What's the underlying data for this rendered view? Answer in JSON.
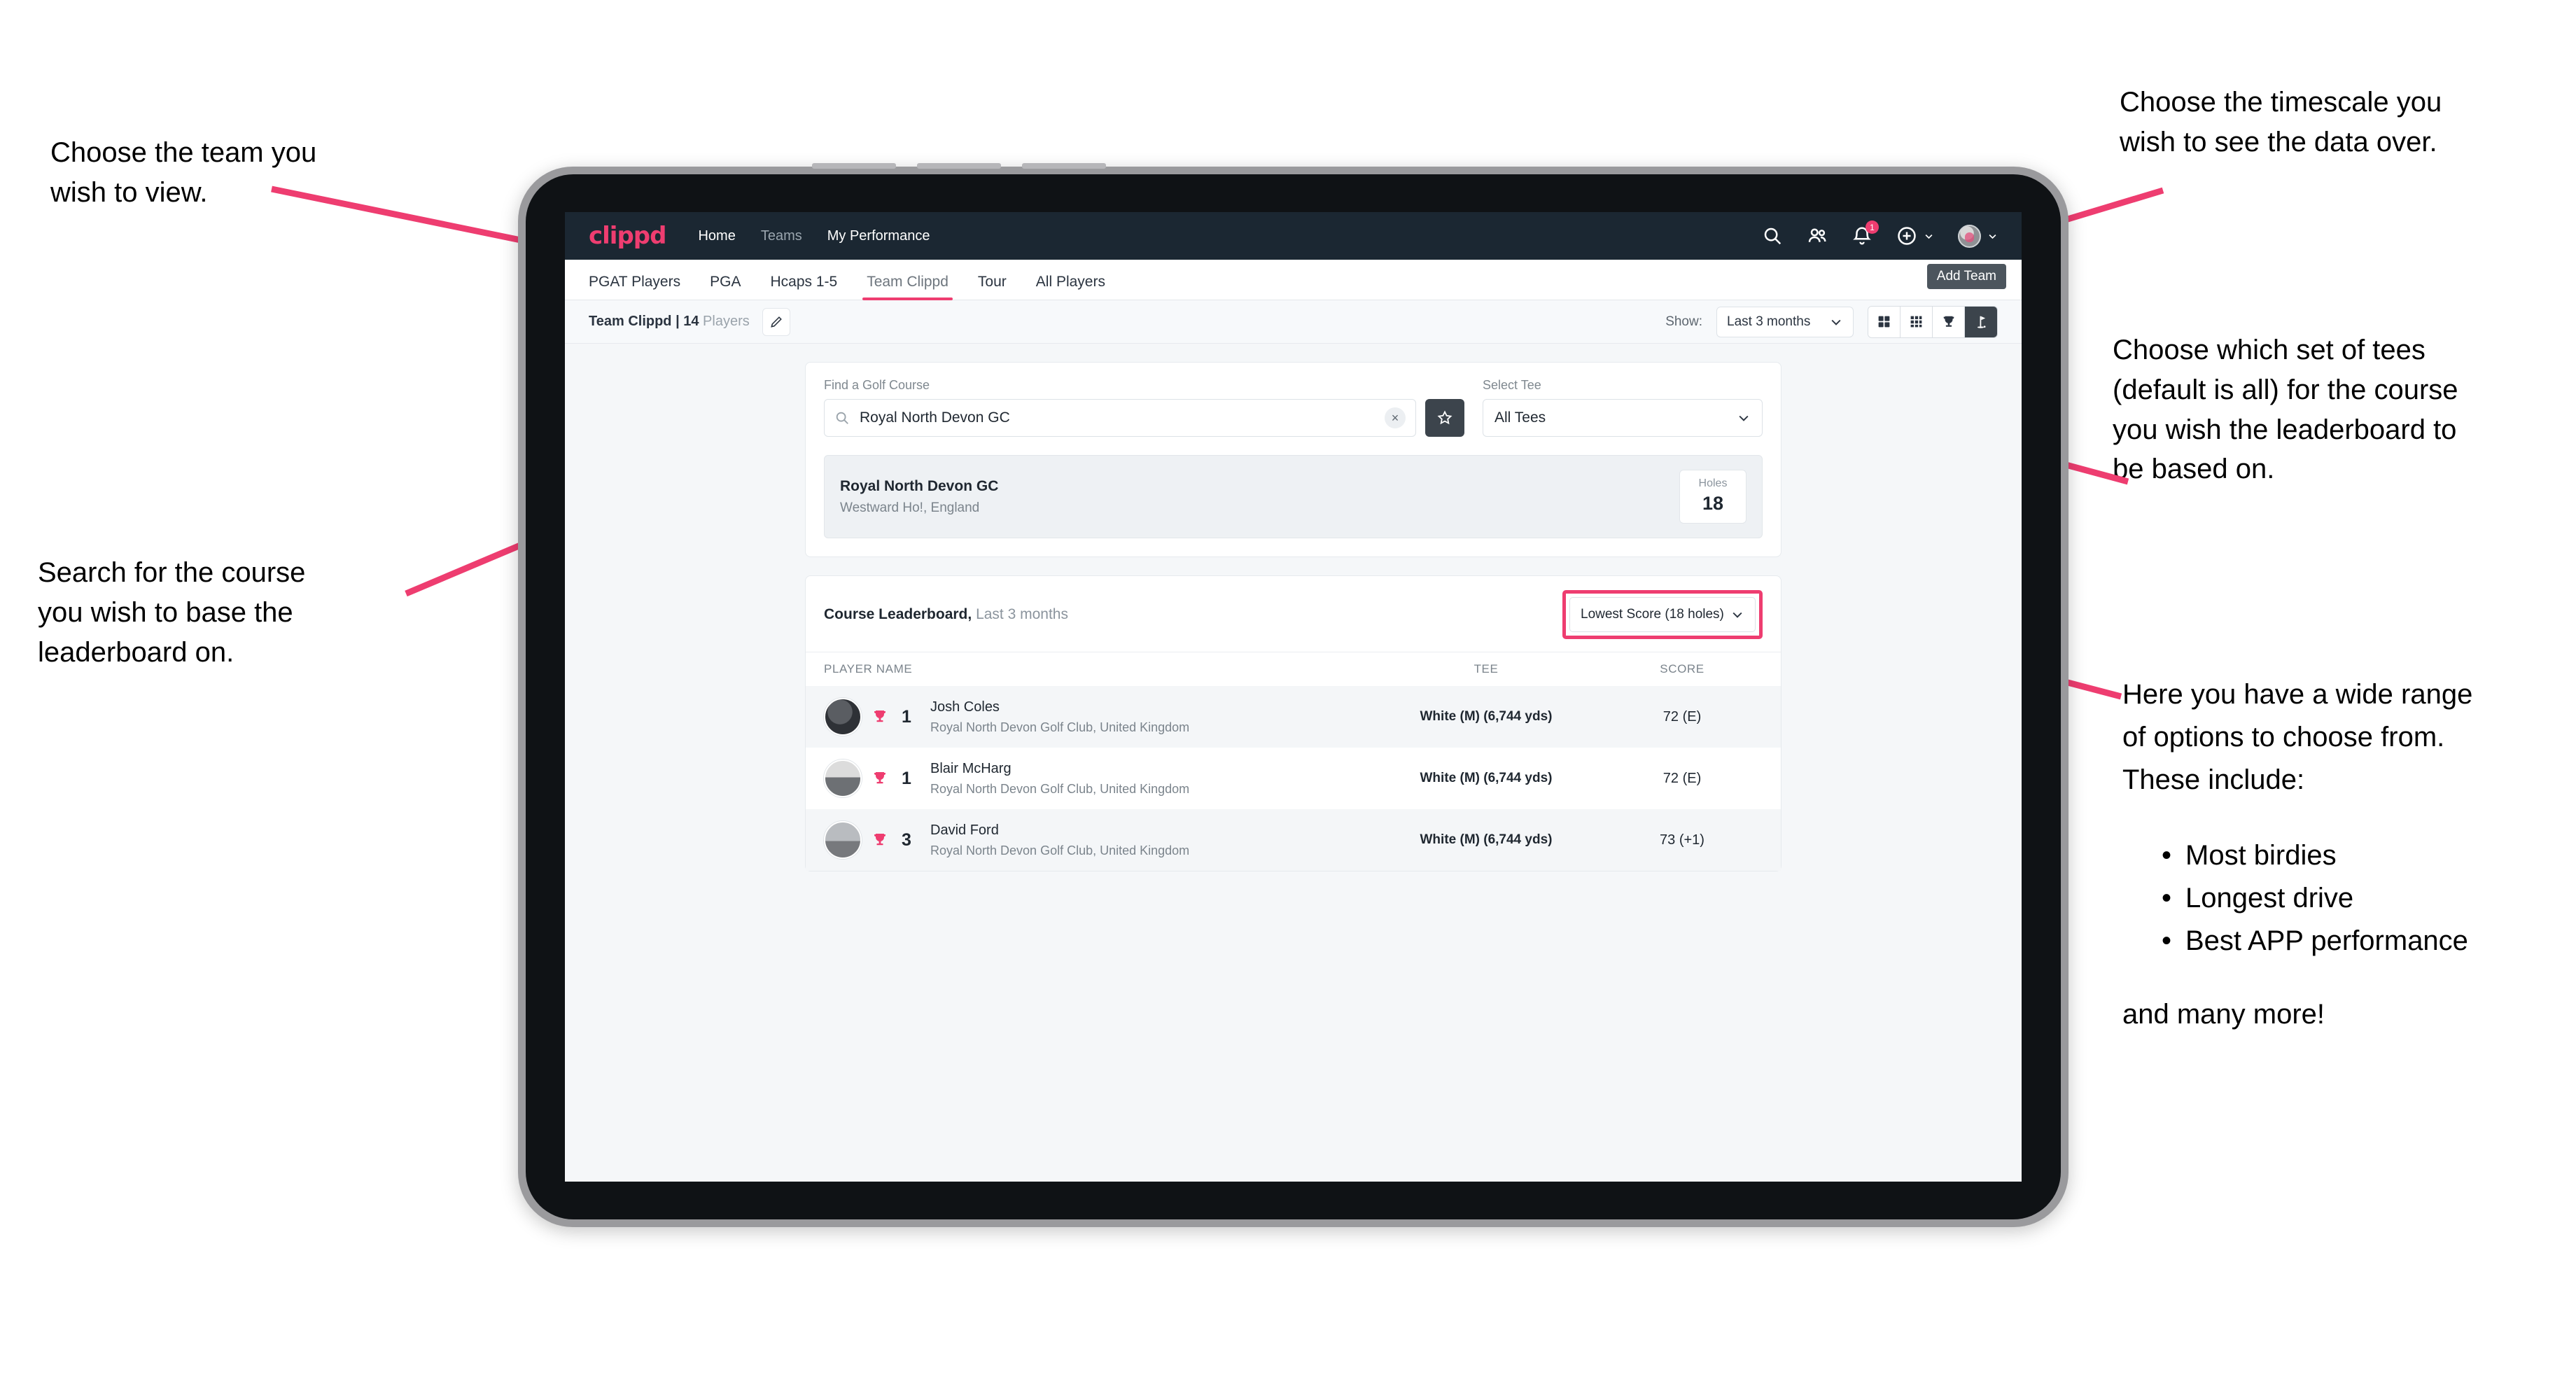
{
  "annotations": {
    "team": "Choose the team you\nwish to view.",
    "timescale": "Choose the timescale you\nwish to see the data over.",
    "tees": "Choose which set of tees\n(default is all) for the course\nyou wish the leaderboard to\nbe based on.",
    "search": "Search for the course\nyou wish to base the\nleaderboard on.",
    "options_intro": "Here you have a wide range\nof options to choose from.\nThese include:",
    "options_items": [
      "Most birdies",
      "Longest drive",
      "Best APP performance"
    ],
    "options_outro": "and many more!"
  },
  "navbar": {
    "logo": "clippd",
    "links": [
      {
        "label": "Home",
        "state": "active"
      },
      {
        "label": "Teams",
        "state": "dim"
      },
      {
        "label": "My Performance",
        "state": "active"
      }
    ],
    "icons": [
      "search-icon",
      "people-icon",
      "bell-icon",
      "plus-circle-icon",
      "avatar-icon"
    ],
    "notification_count": "1"
  },
  "tabs": [
    {
      "label": "PGAT Players",
      "active": false
    },
    {
      "label": "PGA",
      "active": false
    },
    {
      "label": "Hcaps 1-5",
      "active": false
    },
    {
      "label": "Team Clippd",
      "active": true
    },
    {
      "label": "Tour",
      "active": false
    },
    {
      "label": "All Players",
      "active": false
    }
  ],
  "tooltip": {
    "label": "Add Team"
  },
  "subbar": {
    "team_prefix": "Team Clippd | ",
    "team_count": "14",
    "team_suffix": " Players",
    "edit_icon": "pencil-icon",
    "show_label": "Show:",
    "show_value": "Last 3 months",
    "view_toggles": [
      {
        "icon": "grid-2x2-icon",
        "active": false
      },
      {
        "icon": "grid-3x3-icon",
        "active": false
      },
      {
        "icon": "trophy-icon",
        "active": false
      },
      {
        "icon": "golf-flag-icon",
        "active": true
      }
    ]
  },
  "search_panel": {
    "course_label": "Find a Golf Course",
    "course_value": "Royal North Devon GC",
    "course_placeholder": "Find a Golf Course",
    "clear_label": "×",
    "favourite_icon": "star-icon",
    "tee_label": "Select Tee",
    "tee_value": "All Tees"
  },
  "course_card": {
    "name": "Royal North Devon GC",
    "location": "Westward Ho!, England",
    "holes_label": "Holes",
    "holes_value": "18"
  },
  "leaderboard": {
    "title": "Course Leaderboard,",
    "subtitle": " Last 3 months",
    "sort_value": "Lowest Score (18 holes)",
    "columns": {
      "player": "PLAYER NAME",
      "tee": "TEE",
      "score": "SCORE"
    },
    "rows": [
      {
        "rank": "1",
        "name": "Josh Coles",
        "club": "Royal North Devon Golf Club, United Kingdom",
        "tee": "White (M) (6,744 yds)",
        "score": "72 (E)"
      },
      {
        "rank": "1",
        "name": "Blair McHarg",
        "club": "Royal North Devon Golf Club, United Kingdom",
        "tee": "White (M) (6,744 yds)",
        "score": "72 (E)"
      },
      {
        "rank": "3",
        "name": "David Ford",
        "club": "Royal North Devon Golf Club, United Kingdom",
        "tee": "White (M) (6,744 yds)",
        "score": "73 (+1)"
      }
    ]
  },
  "colors": {
    "accent": "#ee3d70",
    "navbar": "#1b2732",
    "dark_control": "#3c444c"
  }
}
